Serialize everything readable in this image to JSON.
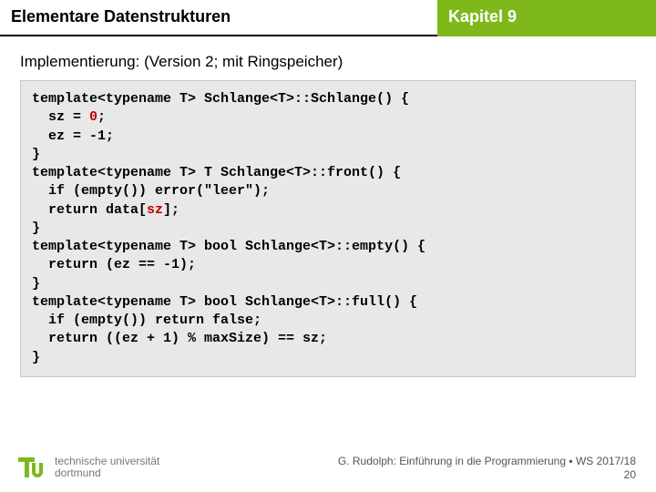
{
  "header": {
    "left": "Elementare Datenstrukturen",
    "right": "Kapitel 9"
  },
  "subtitle": "Implementierung: (Version 2; mit Ringspeicher)",
  "code": {
    "l1a": "template<typename T> Schlange<T>::Schlange() {",
    "l2a": "  sz = ",
    "l2b": "0",
    "l2c": ";",
    "l3": "  ez = -1;",
    "l4": "}",
    "l5": "template<typename T> T Schlange<T>::front() {",
    "l6": "  if (empty()) error(\"leer\");",
    "l7a": "  return data[",
    "l7b": "sz",
    "l7c": "];",
    "l8": "}",
    "l9": "template<typename T> bool Schlange<T>::empty() {",
    "l10": "  return (ez == -1);",
    "l11": "}",
    "l12": "template<typename T> bool Schlange<T>::full() {",
    "l13": "  if (empty()) return false;",
    "l14": "  return ((ez + 1) % maxSize) == sz;",
    "l15": "}"
  },
  "footer": {
    "uni1": "technische universität",
    "uni2": "dortmund",
    "credit": "G. Rudolph: Einführung in die Programmierung ▪ WS 2017/18",
    "page": "20"
  },
  "colors": {
    "accent": "#7fb81a"
  }
}
